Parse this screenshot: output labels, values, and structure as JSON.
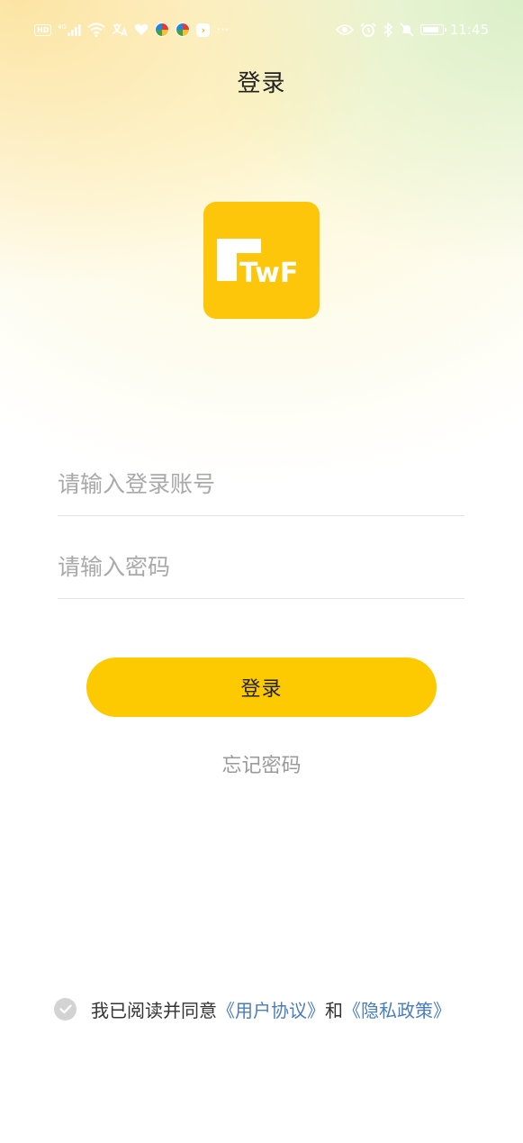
{
  "status_bar": {
    "hd": "HD",
    "network": "4G",
    "more": "···",
    "time": "11:45"
  },
  "header": {
    "title": "登录"
  },
  "logo": {
    "text": "TwF",
    "color": "#fdc60a"
  },
  "form": {
    "account_placeholder": "请输入登录账号",
    "password_placeholder": "请输入密码"
  },
  "login_button": {
    "label": "登录",
    "color": "#fdc900"
  },
  "forgot_password": {
    "label": "忘记密码"
  },
  "agreement": {
    "prefix": "我已阅读并同意",
    "user_agreement": "《用户协议》",
    "conjunction": "和",
    "privacy_policy": "《隐私政策》",
    "link_color": "#4a7dc0"
  }
}
